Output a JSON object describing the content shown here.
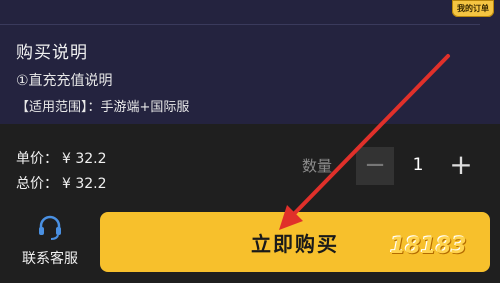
{
  "header": {
    "badge_text": "我的订单"
  },
  "description": {
    "title": "购买说明",
    "line1": "①直充充值说明",
    "line2": "【适用范围】：手游端+国际服"
  },
  "pricing": {
    "unit_label": "单价：",
    "unit_value": "¥ 32.2",
    "total_label": "总价：",
    "total_value": "¥ 32.2"
  },
  "quantity": {
    "label": "数量",
    "value": "1",
    "minus_symbol": "−",
    "plus_symbol": "+"
  },
  "footer": {
    "service_label": "联系客服",
    "buy_label": "立即购买"
  },
  "watermark": {
    "text": "18183"
  },
  "colors": {
    "buy_button": "#f7c02c",
    "top_panel": "#24233f",
    "annotation_arrow": "#e0302a"
  }
}
